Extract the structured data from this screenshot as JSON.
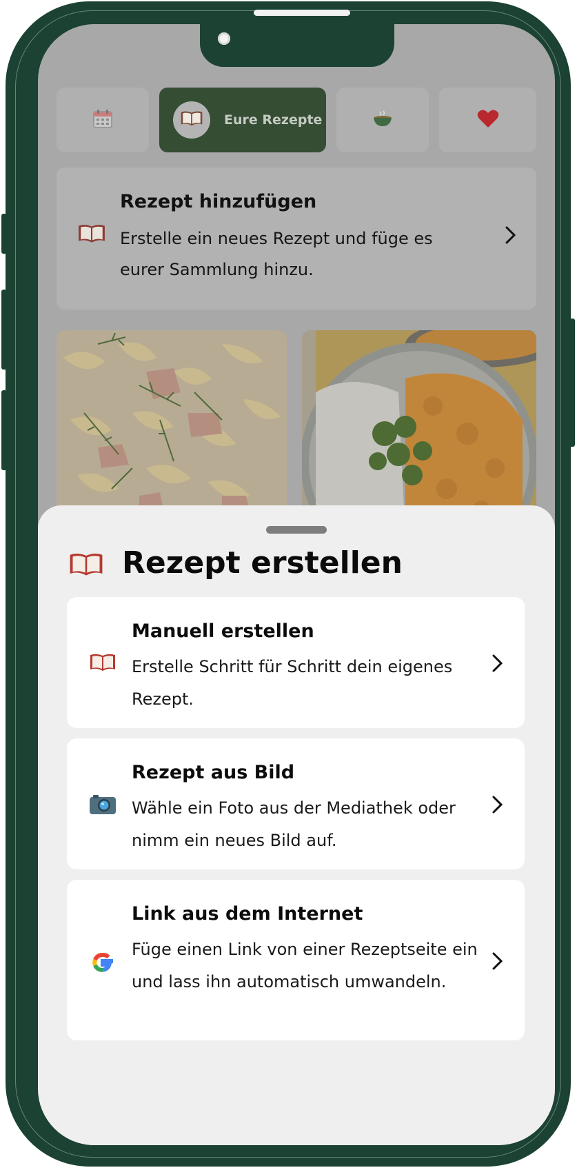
{
  "tabs": [
    {
      "icon": "calendar-icon",
      "label": ""
    },
    {
      "icon": "book-icon",
      "label": "Eure Rezepte",
      "active": true
    },
    {
      "icon": "bowl-icon",
      "label": ""
    },
    {
      "icon": "heart-icon",
      "label": ""
    }
  ],
  "add_recipe": {
    "icon": "book-icon",
    "title": "Rezept hinzufügen",
    "description": "Erstelle ein neues Rezept und füge es eurer Sammlung hinzu."
  },
  "recipe_photos": [
    "pasta-photo",
    "curry-rice-photo"
  ],
  "sheet": {
    "icon": "book-icon",
    "title": "Rezept erstellen",
    "options": [
      {
        "icon": "book-icon",
        "title": "Manuell erstellen",
        "description": "Erstelle Schritt für Schritt dein eigenes Rezept."
      },
      {
        "icon": "camera-icon",
        "title": "Rezept aus Bild",
        "description": "Wähle ein Foto aus der Mediathek oder nimm ein neues Bild auf."
      },
      {
        "icon": "google-icon",
        "title": "Link aus dem Internet",
        "description": "Füge einen Link von einer Rezeptseite ein und lass ihn automatisch umwandeln."
      }
    ]
  },
  "colors": {
    "frame": "#1b4232",
    "active_tab": "#344d33",
    "scrim": "#a8a8a8",
    "sheet": "#efefef"
  }
}
